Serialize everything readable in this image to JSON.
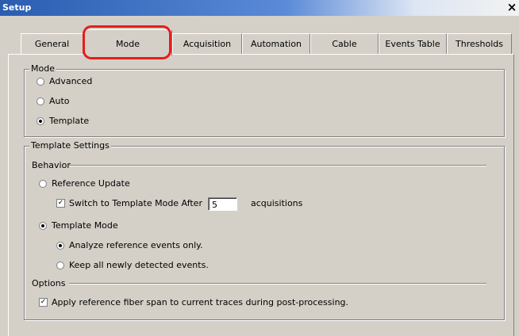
{
  "window": {
    "title": "Setup",
    "close_glyph": "×"
  },
  "tabs": [
    {
      "label": "General",
      "active": false
    },
    {
      "label": "Mode",
      "active": true
    },
    {
      "label": "Acquisition",
      "active": false
    },
    {
      "label": "Automation",
      "active": false
    },
    {
      "label": "Cable",
      "active": false
    },
    {
      "label": "Events Table",
      "active": false
    },
    {
      "label": "Thresholds",
      "active": false
    }
  ],
  "highlight_color": "#e81c1c",
  "mode_group": {
    "legend": "Mode",
    "options": [
      {
        "label": "Advanced",
        "selected": false
      },
      {
        "label": "Auto",
        "selected": false
      },
      {
        "label": "Template",
        "selected": true
      }
    ]
  },
  "template_settings": {
    "legend": "Template Settings",
    "behavior_label": "Behavior",
    "reference_update": {
      "label": "Reference Update",
      "selected": false
    },
    "switch_after": {
      "label": "Switch to Template Mode After",
      "checked": true,
      "value": "5",
      "suffix": "acquisitions"
    },
    "template_mode": {
      "label": "Template Mode",
      "selected": true
    },
    "analyze_only": {
      "label": "Analyze reference events only.",
      "selected": true
    },
    "keep_all": {
      "label": "Keep all newly detected events.",
      "selected": false
    },
    "options_label": "Options",
    "apply_span": {
      "label": "Apply reference fiber span to current traces during post-processing.",
      "checked": true
    }
  }
}
